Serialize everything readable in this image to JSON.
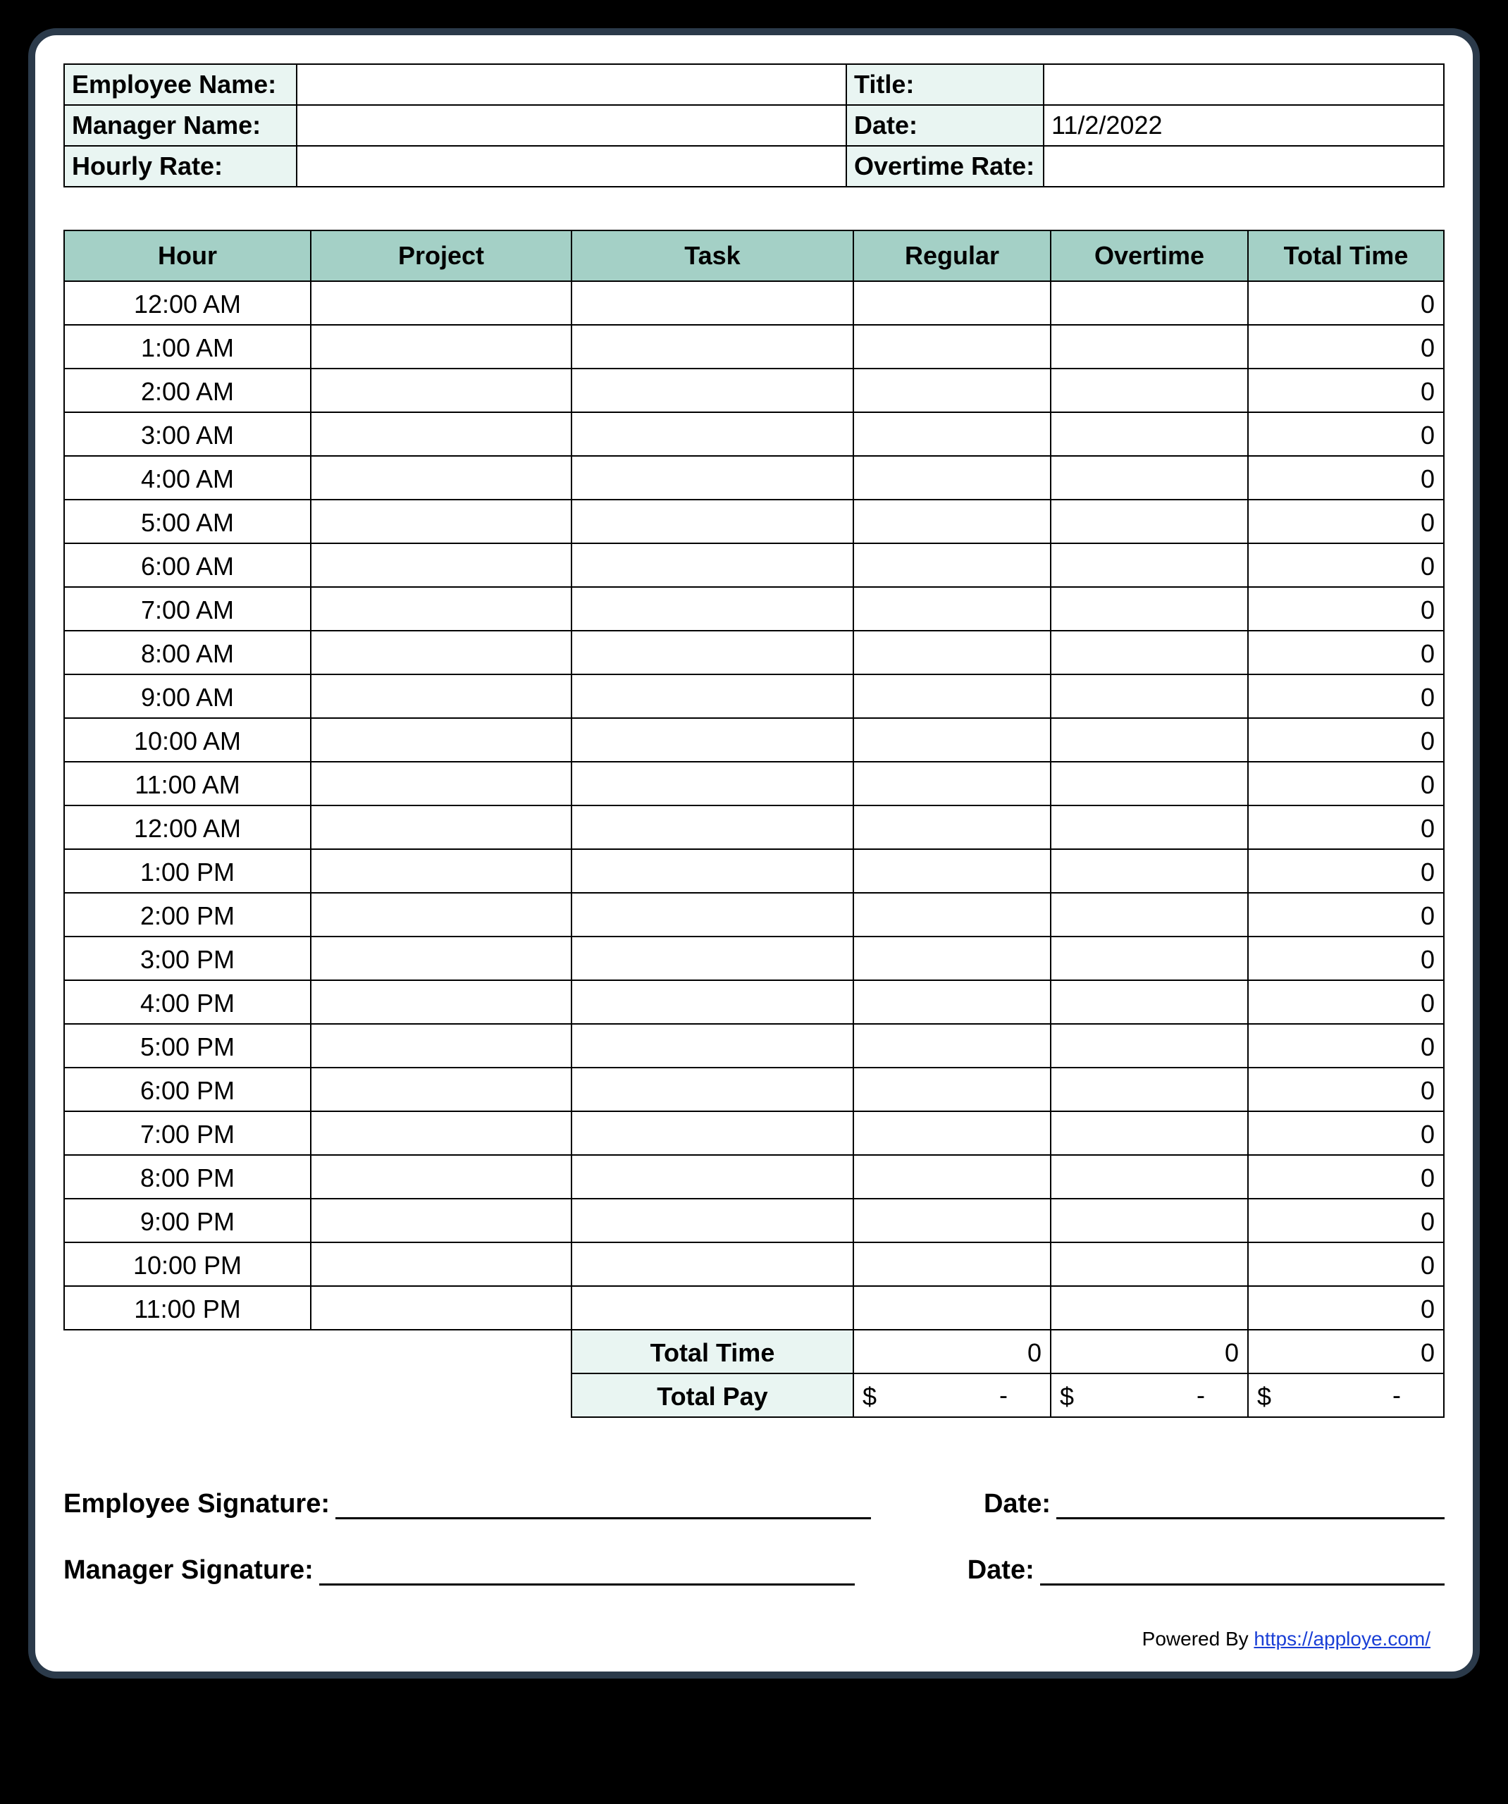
{
  "info": {
    "employee_name_label": "Employee Name:",
    "employee_name_value": "",
    "title_label": "Title:",
    "title_value": "",
    "manager_name_label": "Manager Name:",
    "manager_name_value": "",
    "date_label": "Date:",
    "date_value": "11/2/2022",
    "hourly_rate_label": "Hourly Rate:",
    "hourly_rate_value": "",
    "overtime_rate_label": "Overtime Rate:",
    "overtime_rate_value": ""
  },
  "headers": {
    "hour": "Hour",
    "project": "Project",
    "task": "Task",
    "regular": "Regular",
    "overtime": "Overtime",
    "total_time": "Total Time"
  },
  "rows": [
    {
      "hour": "12:00 AM",
      "project": "",
      "task": "",
      "regular": "",
      "overtime": "",
      "total": "0"
    },
    {
      "hour": "1:00 AM",
      "project": "",
      "task": "",
      "regular": "",
      "overtime": "",
      "total": "0"
    },
    {
      "hour": "2:00 AM",
      "project": "",
      "task": "",
      "regular": "",
      "overtime": "",
      "total": "0"
    },
    {
      "hour": "3:00 AM",
      "project": "",
      "task": "",
      "regular": "",
      "overtime": "",
      "total": "0"
    },
    {
      "hour": "4:00 AM",
      "project": "",
      "task": "",
      "regular": "",
      "overtime": "",
      "total": "0"
    },
    {
      "hour": "5:00 AM",
      "project": "",
      "task": "",
      "regular": "",
      "overtime": "",
      "total": "0"
    },
    {
      "hour": "6:00 AM",
      "project": "",
      "task": "",
      "regular": "",
      "overtime": "",
      "total": "0"
    },
    {
      "hour": "7:00 AM",
      "project": "",
      "task": "",
      "regular": "",
      "overtime": "",
      "total": "0"
    },
    {
      "hour": "8:00 AM",
      "project": "",
      "task": "",
      "regular": "",
      "overtime": "",
      "total": "0"
    },
    {
      "hour": "9:00 AM",
      "project": "",
      "task": "",
      "regular": "",
      "overtime": "",
      "total": "0"
    },
    {
      "hour": "10:00 AM",
      "project": "",
      "task": "",
      "regular": "",
      "overtime": "",
      "total": "0"
    },
    {
      "hour": "11:00 AM",
      "project": "",
      "task": "",
      "regular": "",
      "overtime": "",
      "total": "0"
    },
    {
      "hour": "12:00 AM",
      "project": "",
      "task": "",
      "regular": "",
      "overtime": "",
      "total": "0"
    },
    {
      "hour": "1:00 PM",
      "project": "",
      "task": "",
      "regular": "",
      "overtime": "",
      "total": "0"
    },
    {
      "hour": "2:00 PM",
      "project": "",
      "task": "",
      "regular": "",
      "overtime": "",
      "total": "0"
    },
    {
      "hour": "3:00 PM",
      "project": "",
      "task": "",
      "regular": "",
      "overtime": "",
      "total": "0"
    },
    {
      "hour": "4:00 PM",
      "project": "",
      "task": "",
      "regular": "",
      "overtime": "",
      "total": "0"
    },
    {
      "hour": "5:00 PM",
      "project": "",
      "task": "",
      "regular": "",
      "overtime": "",
      "total": "0"
    },
    {
      "hour": "6:00 PM",
      "project": "",
      "task": "",
      "regular": "",
      "overtime": "",
      "total": "0"
    },
    {
      "hour": "7:00 PM",
      "project": "",
      "task": "",
      "regular": "",
      "overtime": "",
      "total": "0"
    },
    {
      "hour": "8:00 PM",
      "project": "",
      "task": "",
      "regular": "",
      "overtime": "",
      "total": "0"
    },
    {
      "hour": "9:00 PM",
      "project": "",
      "task": "",
      "regular": "",
      "overtime": "",
      "total": "0"
    },
    {
      "hour": "10:00 PM",
      "project": "",
      "task": "",
      "regular": "",
      "overtime": "",
      "total": "0"
    },
    {
      "hour": "11:00 PM",
      "project": "",
      "task": "",
      "regular": "",
      "overtime": "",
      "total": "0"
    }
  ],
  "summary": {
    "total_time_label": "Total Time",
    "total_pay_label": "Total Pay",
    "regular_total": "0",
    "overtime_total": "0",
    "grand_total": "0",
    "pay_symbol": "$",
    "pay_dash": "-"
  },
  "signatures": {
    "employee_label": "Employee Signature:",
    "manager_label": "Manager Signature:",
    "date_label": "Date:"
  },
  "footer": {
    "prefix": "Powered By ",
    "link_text": "https://apploye.com/"
  }
}
